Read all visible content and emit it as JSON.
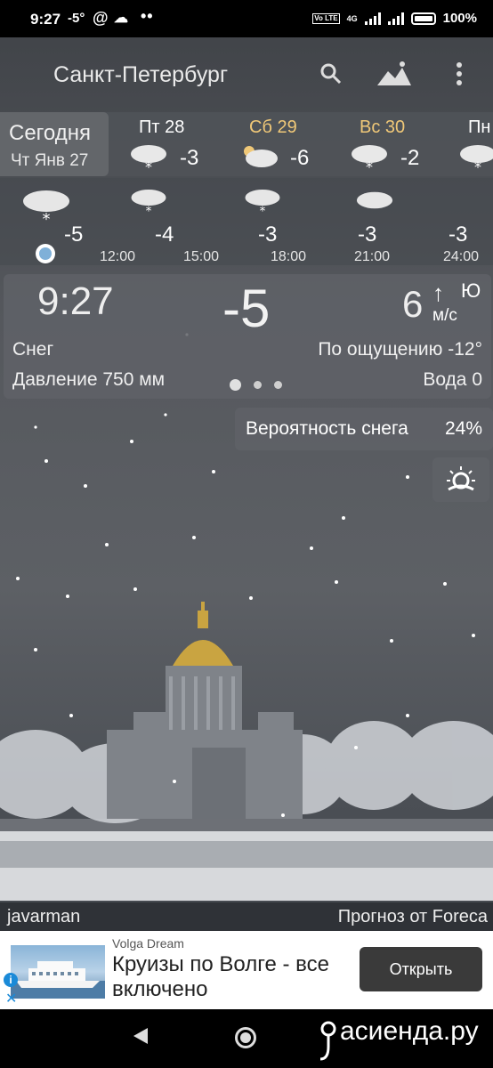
{
  "status_bar": {
    "time": "9:27",
    "temp": "-5°",
    "at": "@",
    "volte": "Vo LTE",
    "network": "4G",
    "battery": "100%"
  },
  "header": {
    "city": "Санкт-Петербург"
  },
  "days": {
    "today_label": "Сегодня",
    "today_date": "Чт Янв 27",
    "items": [
      {
        "name": "Пт 28",
        "temp": "-3",
        "color": "#ffffff"
      },
      {
        "name": "Сб 29",
        "temp": "-6",
        "color": "#f0c878"
      },
      {
        "name": "Вс 30",
        "temp": "-2",
        "color": "#f0c878"
      },
      {
        "name": "Пн",
        "temp": "",
        "color": "#ffffff"
      }
    ]
  },
  "hourly": [
    {
      "time": "",
      "temp": "-5"
    },
    {
      "time": "12:00",
      "temp": "-4"
    },
    {
      "time": "15:00",
      "temp": "-3"
    },
    {
      "time": "18:00",
      "temp": "-3"
    },
    {
      "time": "21:00",
      "temp": "-3"
    },
    {
      "time": "24:00",
      "temp": "-3"
    }
  ],
  "current": {
    "clock": "9:27",
    "temp": "-5",
    "wind_speed": "6",
    "wind_arrow": "↑",
    "wind_dir": "Ю",
    "wind_unit": "м/с",
    "condition": "Снег",
    "feels_like": "По ощущению -12°",
    "pressure": "Давление 750 мм",
    "water": "Вода 0"
  },
  "precip": {
    "label": "Вероятность снега",
    "value": "24%"
  },
  "credits": {
    "photo": "javarman",
    "provider": "Прогноз от Foreca"
  },
  "ad": {
    "brand": "Volga Dream",
    "title": "Круизы по Волге - все включено",
    "button": "Открыть"
  },
  "watermark": "асиенда.ру"
}
